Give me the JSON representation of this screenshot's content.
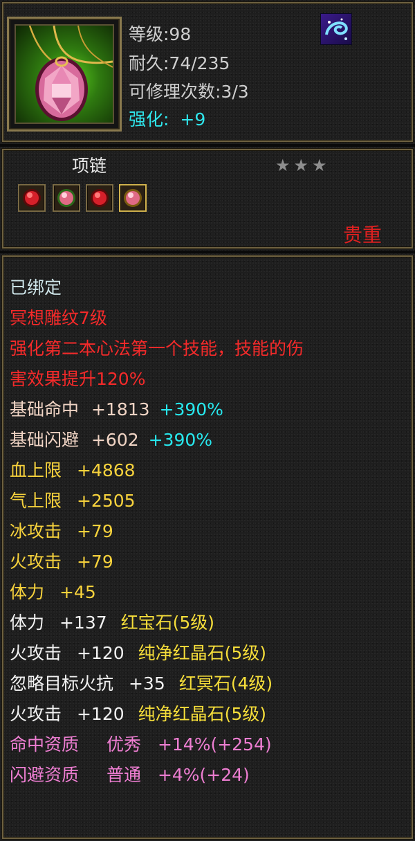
{
  "header": {
    "level": "等级:98",
    "durability": "耐久:74/235",
    "repairs": "可修理次数:3/3",
    "enhance_label": "强化:",
    "enhance_value": "+9"
  },
  "item": {
    "type": "项链",
    "stars": [
      "★",
      "★",
      "★"
    ],
    "rarity": "贵重",
    "sockets": [
      "ruby-gem",
      "pink-crystal-gem",
      "ruby-gem",
      "pink-crystal-gem"
    ]
  },
  "details": {
    "bound": "已绑定",
    "engraving": "冥想雕纹7级",
    "effect_line1": "强化第二本心法第一个技能，技能的伤",
    "effect_line2": "害效果提升120%",
    "base_stats": [
      {
        "name": "基础命中",
        "value": "+1813",
        "bonus": "+390%"
      },
      {
        "name": "基础闪避",
        "value": "+602",
        "bonus": "+390%"
      }
    ],
    "attributes": [
      {
        "name": "血上限",
        "value": "+4868"
      },
      {
        "name": "气上限",
        "value": "+2505"
      },
      {
        "name": "冰攻击",
        "value": "+79"
      },
      {
        "name": "火攻击",
        "value": "+79"
      },
      {
        "name": "体力",
        "value": "+45"
      }
    ],
    "gem_stats": [
      {
        "name": "体力",
        "value": "+137",
        "gem": "红宝石(5级)"
      },
      {
        "name": "火攻击",
        "value": "+120",
        "gem": "纯净红晶石(5级)"
      },
      {
        "name": "忽略目标火抗",
        "value": "+35",
        "gem": "红冥石(4级)"
      },
      {
        "name": "火攻击",
        "value": "+120",
        "gem": "纯净红晶石(5级)"
      }
    ],
    "aptitudes": [
      {
        "name": "命中资质",
        "grade": "优秀",
        "value": "+14%(+254)"
      },
      {
        "name": "闪避资质",
        "grade": "普通",
        "value": "+4%(+24)"
      }
    ]
  },
  "colors": {
    "engraving_red": "#f42a2a",
    "bonus_cyan": "#27e8ee",
    "attribute_yellow": "#f7d23c",
    "aptitude_pink": "#ee7ed2",
    "rarity_red": "#e02020"
  },
  "icons": {
    "item": "pink-gem-necklace-icon",
    "badge": "blue-swirl-badge-icon"
  }
}
